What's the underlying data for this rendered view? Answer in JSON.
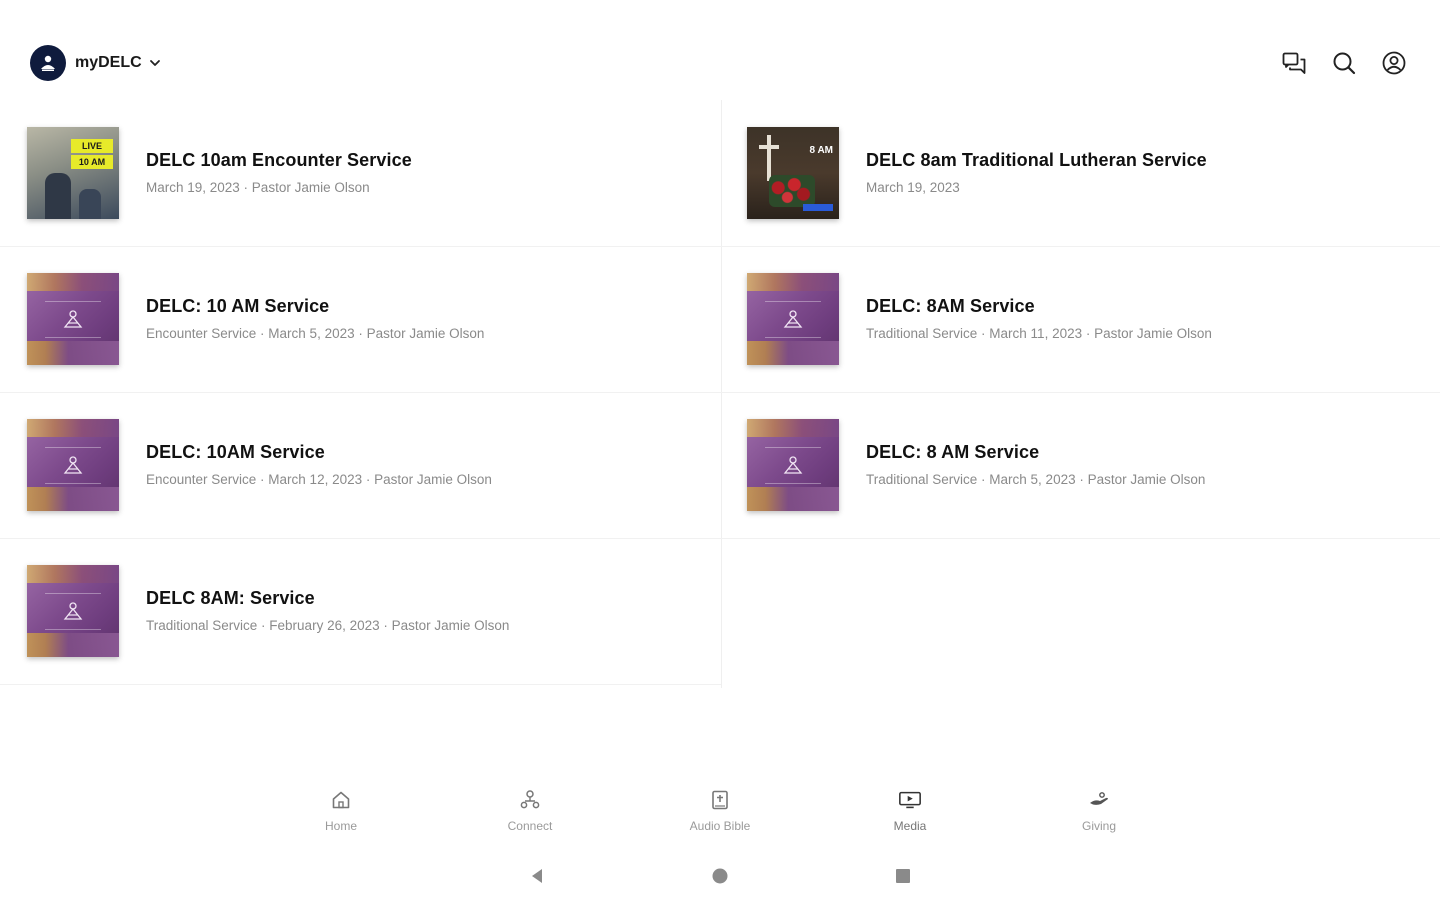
{
  "header": {
    "app_name": "myDELC"
  },
  "items": [
    {
      "title": "DELC 10am Encounter Service",
      "subtitle": "March 19, 2023 · Pastor Jamie Olson",
      "thumb": "live",
      "thumb_tag1": "LIVE",
      "thumb_tag2": "10 AM"
    },
    {
      "title": "DELC 8am Traditional Lutheran Service",
      "subtitle": "March 19, 2023",
      "thumb": "traditional",
      "thumb_tag": "8 AM"
    },
    {
      "title": "DELC: 10 AM Service",
      "subtitle": "Encounter Service · March 5, 2023 · Pastor Jamie Olson",
      "thumb": "purple"
    },
    {
      "title": "DELC: 8AM Service",
      "subtitle": "Traditional Service · March 11, 2023 · Pastor Jamie Olson",
      "thumb": "purple"
    },
    {
      "title": "DELC: 10AM Service",
      "subtitle": "Encounter Service · March 12, 2023 · Pastor Jamie Olson",
      "thumb": "purple"
    },
    {
      "title": "DELC: 8 AM Service",
      "subtitle": "Traditional Service · March 5, 2023 · Pastor Jamie Olson",
      "thumb": "purple"
    },
    {
      "title": "DELC 8AM: Service",
      "subtitle": "Traditional Service · February 26, 2023 · Pastor Jamie Olson",
      "thumb": "purple"
    }
  ],
  "bottom_nav": [
    {
      "label": "Home",
      "icon": "home-icon"
    },
    {
      "label": "Connect",
      "icon": "connect-icon"
    },
    {
      "label": "Audio Bible",
      "icon": "bible-icon"
    },
    {
      "label": "Media",
      "icon": "media-icon",
      "active": true
    },
    {
      "label": "Giving",
      "icon": "giving-icon"
    }
  ],
  "colors": {
    "brand_dark": "#0f1b3d",
    "title": "#111111",
    "subtitle": "#8a8a8a",
    "nav_label": "#9a9a9a"
  }
}
